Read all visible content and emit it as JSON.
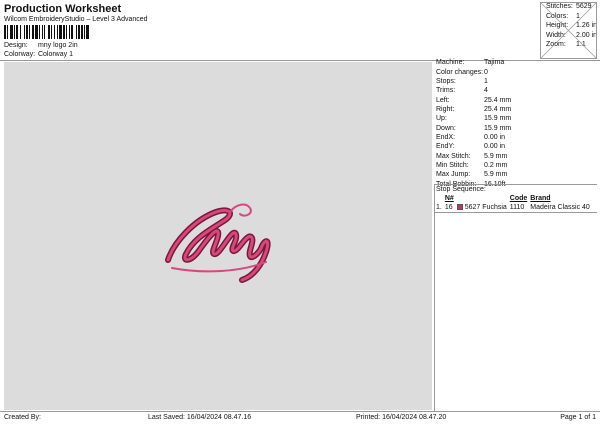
{
  "header": {
    "title": "Production Worksheet",
    "subtitle": "Wilcom EmbroideryStudio – Level 3 Advanced",
    "design_label": "Design:",
    "design_value": "mny logo 2in",
    "colorway_label": "Colorway:",
    "colorway_value": "Colorway 1"
  },
  "summary": [
    {
      "label": "Stitches:",
      "value": "5629"
    },
    {
      "label": "Colors:",
      "value": "1"
    },
    {
      "label": "Height:",
      "value": "1.26 in"
    },
    {
      "label": "Width:",
      "value": "2.00 in"
    },
    {
      "label": "Zoom:",
      "value": "1:1"
    }
  ],
  "details": [
    {
      "label": "Machine:",
      "value": "Tajima"
    },
    {
      "label": "Color changes:",
      "value": "0"
    },
    {
      "label": "Stops:",
      "value": "1"
    },
    {
      "label": "Trims:",
      "value": "4"
    },
    {
      "label": "Left:",
      "value": "25.4 mm"
    },
    {
      "label": "Right:",
      "value": "25.4 mm"
    },
    {
      "label": "Up:",
      "value": "15.9 mm"
    },
    {
      "label": "Down:",
      "value": "15.9 mm"
    },
    {
      "label": "EndX:",
      "value": "0.00 in"
    },
    {
      "label": "EndY:",
      "value": "0.00 in"
    },
    {
      "label": "Max Stitch:",
      "value": "5.9 mm"
    },
    {
      "label": "Min Stitch:",
      "value": "0.2 mm"
    },
    {
      "label": "Max Jump:",
      "value": "5.9 mm"
    },
    {
      "label": "Total Bobbin:",
      "value": "16.10ft"
    }
  ],
  "stop_sequence": {
    "label": "Stop Sequence:",
    "columns": [
      "N#",
      "",
      "Code",
      "Brand"
    ],
    "rows": [
      {
        "index": "1.",
        "n": "16",
        "swatch_color": "#c8325a",
        "stitches": "5627",
        "name": "Fuchsia",
        "code": "1110",
        "brand": "Madeira Classic 40"
      }
    ]
  },
  "footer": {
    "created_by": "Created By:",
    "last_saved": "Last Saved: 16/04/2024 08.47.16",
    "printed": "Printed: 16/04/2024 08.47.20",
    "page": "Page 1 of 1"
  },
  "design_preview": {
    "thread_color": "#d7487f",
    "outline_color": "#7a1836"
  }
}
